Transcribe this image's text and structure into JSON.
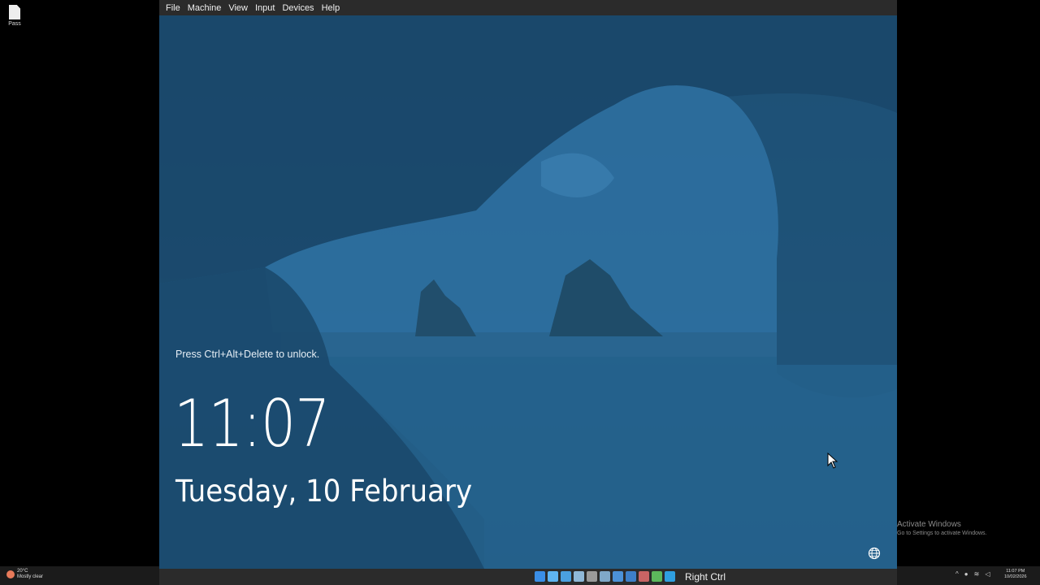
{
  "desktop": {
    "icon_label": "Pass",
    "activate_title": "Activate Windows",
    "activate_subtitle": "Go to Settings to activate Windows."
  },
  "host_taskbar": {
    "weather_temp": "20°C",
    "weather_desc": "Mostly clear",
    "clock_time": "11:07 PM",
    "clock_date": "10/02/2026"
  },
  "vm": {
    "menu": [
      "File",
      "Machine",
      "View",
      "Input",
      "Devices",
      "Help"
    ],
    "host_key": "Right Ctrl",
    "status_icon_colors": [
      "#3a8ee6",
      "#5fb4f0",
      "#4aa0e0",
      "#8fb8d8",
      "#9a9a9a",
      "#7fa8c8",
      "#4c92d8",
      "#3d7fc8",
      "#c86464",
      "#5cb85c",
      "#2f9fe0"
    ]
  },
  "lock_screen": {
    "message": "Press Ctrl+Alt+Delete to unlock.",
    "time": "11:07",
    "date": "Tuesday, 10 February"
  }
}
